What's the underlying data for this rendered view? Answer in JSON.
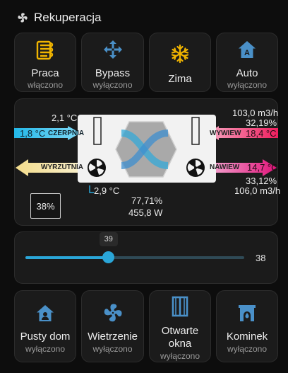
{
  "header": {
    "title": "Rekuperacja",
    "icon": "fan-icon"
  },
  "top_tiles": [
    {
      "label": "Praca",
      "state": "włączono",
      "icon": "heat-exchanger-icon",
      "color": "#f0b400"
    },
    {
      "label": "Bypass",
      "state": "wyłączono",
      "icon": "arrows-cross-icon",
      "color": "#4a90c8"
    },
    {
      "label": "Zima",
      "state": "",
      "icon": "snowflake-icon",
      "color": "#f0b400"
    },
    {
      "label": "Auto",
      "state": "wyłączono",
      "icon": "home-auto-icon",
      "color": "#4a90c8"
    }
  ],
  "diagram": {
    "czerpnia": {
      "name": "CZERPNIA",
      "temp": "1,8 °C",
      "color": "#1fb7e6"
    },
    "wywiew": {
      "name": "WYWIEW",
      "temp": "18,4 °C",
      "flow": "103,0 m3/h",
      "percent": "32,19%",
      "color": "#f0145a"
    },
    "wyrzutnia": {
      "name": "WYRZUTNIA",
      "color": "#f5e39a"
    },
    "nawiew": {
      "name": "NAWIEW",
      "temp": "14,7 °C",
      "flow": "106,0 m3/h",
      "percent": "33,12%",
      "color": "#e0147a"
    },
    "temp_left_top": "2,1 °C",
    "temp_bottom": "2,9 °C",
    "efficiency": "77,71%",
    "power": "455,8 W",
    "fan_percent": "38%"
  },
  "slider": {
    "value": 38,
    "min": 0,
    "max": 100,
    "tooltip": "39",
    "display": "38"
  },
  "bottom_tiles": [
    {
      "label": "Pusty dom",
      "state": "wyłączono",
      "icon": "home-alert-icon",
      "color": "#4a90c8"
    },
    {
      "label": "Wietrzenie",
      "state": "wyłączono",
      "icon": "fan-icon",
      "color": "#4a90c8"
    },
    {
      "label": "Otwarte okna",
      "label_line1": "Otwarte",
      "label_line2": "okna",
      "state": "wyłączono",
      "icon": "window-open-icon",
      "color": "#4a90c8"
    },
    {
      "label": "Kominek",
      "state": "wyłączono",
      "icon": "fireplace-icon",
      "color": "#4a90c8"
    }
  ]
}
